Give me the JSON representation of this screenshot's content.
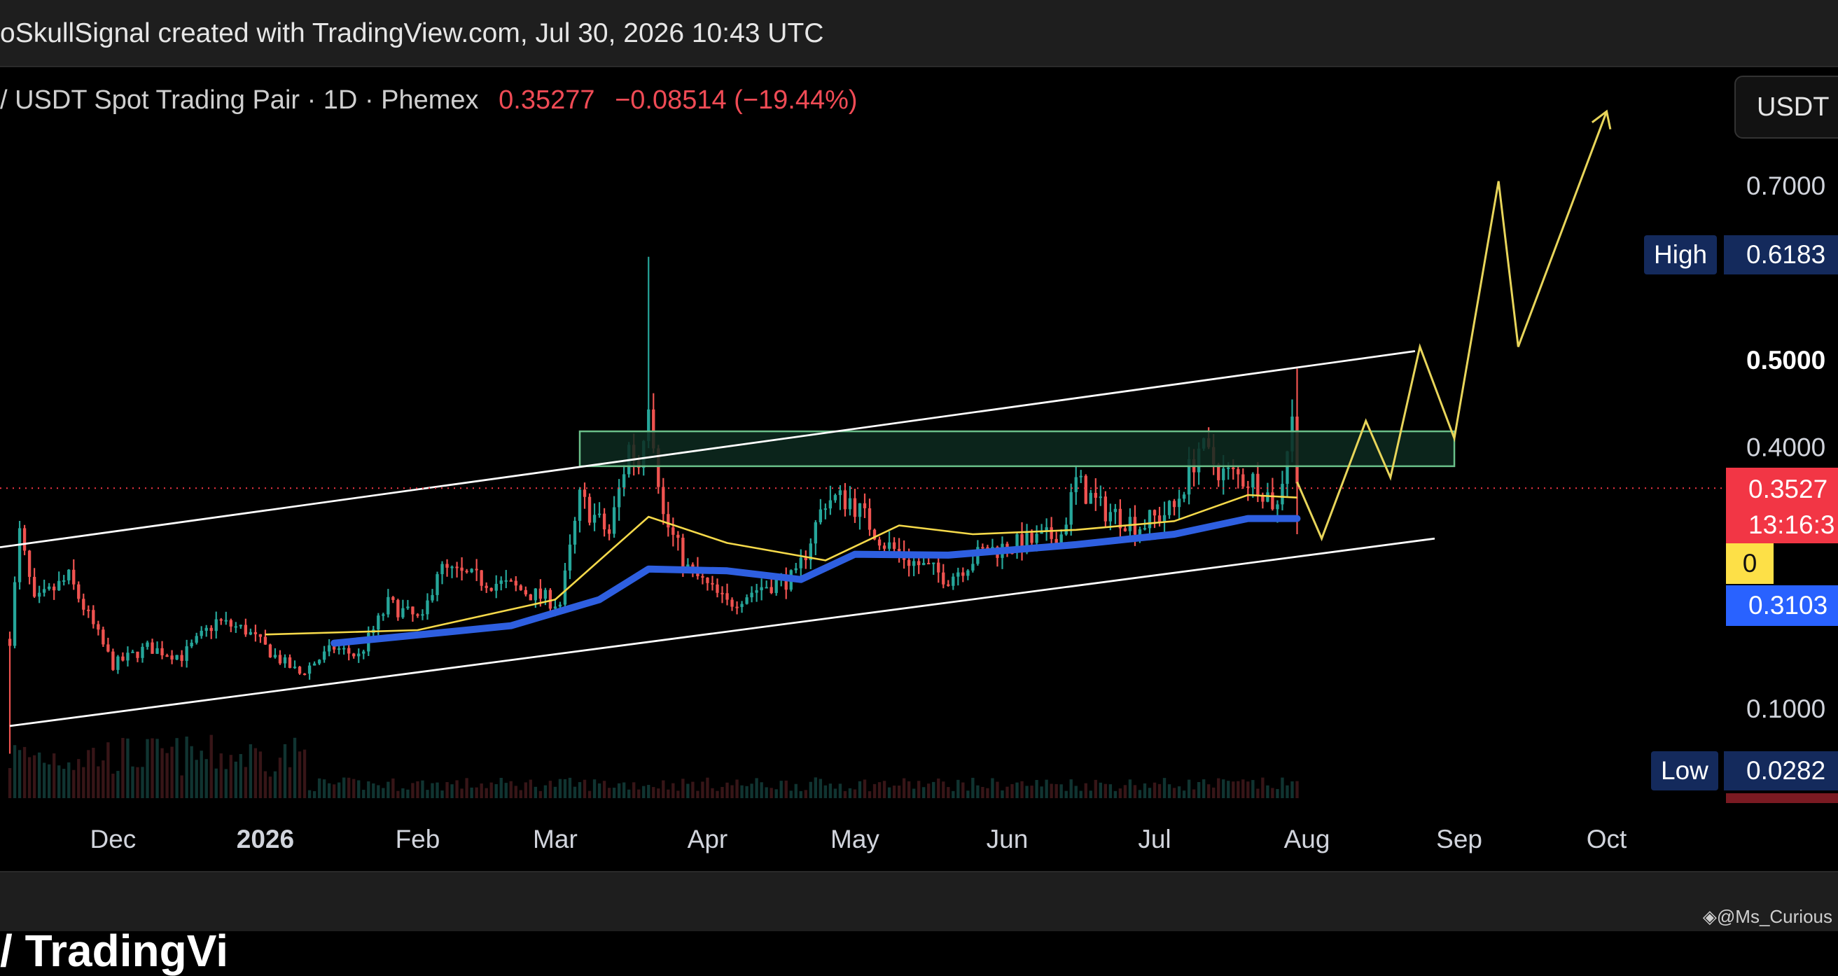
{
  "header": {
    "caption": "oSkullSignal created with TradingView.com, Jul 30, 2026 10:43 UTC"
  },
  "legend": {
    "symbol": "/ USDT Spot Trading Pair · 1D · Phemex",
    "last": "0.35277",
    "change": "−0.08514 (−19.44%)"
  },
  "unit_button": "USDT",
  "markers": {
    "high_label": "High",
    "high_value": "0.6183",
    "low_label": "Low",
    "low_value": "0.0282",
    "price_tag": "0.3527",
    "countdown": "13:16:3",
    "ma_fast_tag": "0",
    "ma_slow_tag": "0.3103"
  },
  "footer": {
    "credit": "@Ms_Curious",
    "logo_text": "/ TradingVi"
  },
  "colors": {
    "background": "#000000",
    "up": "#26a69a",
    "down": "#ef5350",
    "ma_fast": "#f5d94a",
    "ma_slow": "#2e5fe0",
    "channel": "#ffffff",
    "zone": "#1f6b46",
    "projection": "#e8d55a",
    "price_tag": "#f23645",
    "ma_slow_tag": "#2962ff",
    "ma_fast_tag": "#fde047",
    "high_low_tag": "#142a5c"
  },
  "chart_data": {
    "type": "candlestick",
    "xlabel": "",
    "ylabel": "",
    "y_ticks": [
      "0.1000",
      "0.4000",
      "0.5000",
      "0.7000"
    ],
    "ylim": [
      0.0,
      0.82
    ],
    "x_ticks": [
      {
        "date": "2025-12-01",
        "label": "Dec"
      },
      {
        "date": "2026-01-01",
        "label": "2026"
      },
      {
        "date": "2026-02-01",
        "label": "Feb"
      },
      {
        "date": "2026-03-01",
        "label": "Mar"
      },
      {
        "date": "2026-04-01",
        "label": "Apr"
      },
      {
        "date": "2026-05-01",
        "label": "May"
      },
      {
        "date": "2026-06-01",
        "label": "Jun"
      },
      {
        "date": "2026-07-01",
        "label": "Jul"
      },
      {
        "date": "2026-08-01",
        "label": "Aug"
      },
      {
        "date": "2026-09-01",
        "label": "Sep"
      },
      {
        "date": "2026-10-01",
        "label": "Oct"
      }
    ],
    "xlim": [
      "2025-11-08",
      "2026-10-26"
    ],
    "price_anchors": [
      [
        "2025-11-10",
        0.18
      ],
      [
        "2025-11-12",
        0.3
      ],
      [
        "2025-11-15",
        0.22
      ],
      [
        "2025-11-22",
        0.25
      ],
      [
        "2025-12-01",
        0.15
      ],
      [
        "2025-12-08",
        0.17
      ],
      [
        "2025-12-15",
        0.16
      ],
      [
        "2025-12-22",
        0.2
      ],
      [
        "2025-12-28",
        0.19
      ],
      [
        "2026-01-03",
        0.16
      ],
      [
        "2026-01-08",
        0.14
      ],
      [
        "2026-01-15",
        0.17
      ],
      [
        "2026-01-20",
        0.16
      ],
      [
        "2026-01-26",
        0.22
      ],
      [
        "2026-02-02",
        0.2
      ],
      [
        "2026-02-05",
        0.26
      ],
      [
        "2026-02-12",
        0.25
      ],
      [
        "2026-02-20",
        0.24
      ],
      [
        "2026-02-25",
        0.23
      ],
      [
        "2026-03-02",
        0.22
      ],
      [
        "2026-03-06",
        0.34
      ],
      [
        "2026-03-12",
        0.3
      ],
      [
        "2026-03-16",
        0.4
      ],
      [
        "2026-03-18",
        0.38
      ],
      [
        "2026-03-20",
        0.46
      ],
      [
        "2026-03-23",
        0.32
      ],
      [
        "2026-03-28",
        0.26
      ],
      [
        "2026-04-05",
        0.22
      ],
      [
        "2026-04-12",
        0.24
      ],
      [
        "2026-04-19",
        0.25
      ],
      [
        "2026-04-25",
        0.34
      ],
      [
        "2026-04-30",
        0.34
      ],
      [
        "2026-05-07",
        0.29
      ],
      [
        "2026-05-12",
        0.27
      ],
      [
        "2026-05-20",
        0.25
      ],
      [
        "2026-05-27",
        0.28
      ],
      [
        "2026-06-05",
        0.29
      ],
      [
        "2026-06-12",
        0.3
      ],
      [
        "2026-06-15",
        0.36
      ],
      [
        "2026-06-20",
        0.33
      ],
      [
        "2026-06-28",
        0.31
      ],
      [
        "2026-07-05",
        0.33
      ],
      [
        "2026-07-10",
        0.4
      ],
      [
        "2026-07-15",
        0.37
      ],
      [
        "2026-07-22",
        0.36
      ],
      [
        "2026-07-26",
        0.33
      ],
      [
        "2026-07-29",
        0.44
      ],
      [
        "2026-07-30",
        0.35277
      ]
    ],
    "ohlc_summary": {
      "high": 0.6183,
      "low": 0.0282,
      "last": 0.35277,
      "change": -0.08514,
      "change_pct": -19.44
    },
    "ma_fast": [
      [
        "2026-01-01",
        0.185
      ],
      [
        "2026-02-01",
        0.19
      ],
      [
        "2026-03-01",
        0.225
      ],
      [
        "2026-03-20",
        0.32
      ],
      [
        "2026-04-05",
        0.29
      ],
      [
        "2026-04-25",
        0.27
      ],
      [
        "2026-05-10",
        0.31
      ],
      [
        "2026-05-25",
        0.3
      ],
      [
        "2026-06-15",
        0.305
      ],
      [
        "2026-07-05",
        0.315
      ],
      [
        "2026-07-20",
        0.345
      ],
      [
        "2026-07-30",
        0.342
      ]
    ],
    "ma_slow": [
      [
        "2026-01-15",
        0.175
      ],
      [
        "2026-02-20",
        0.195
      ],
      [
        "2026-03-10",
        0.225
      ],
      [
        "2026-03-20",
        0.26
      ],
      [
        "2026-04-05",
        0.258
      ],
      [
        "2026-04-20",
        0.248
      ],
      [
        "2026-05-01",
        0.277
      ],
      [
        "2026-05-20",
        0.276
      ],
      [
        "2026-06-15",
        0.288
      ],
      [
        "2026-07-05",
        0.3
      ],
      [
        "2026-07-20",
        0.318
      ],
      [
        "2026-07-30",
        0.318
      ]
    ],
    "channel_upper": [
      [
        "2025-11-08",
        0.285
      ],
      [
        "2026-08-23",
        0.51
      ]
    ],
    "channel_lower": [
      [
        "2025-11-10",
        0.08
      ],
      [
        "2026-08-27",
        0.295
      ]
    ],
    "supply_zone": {
      "x0": "2026-03-06",
      "x1": "2026-08-31",
      "y0": 0.378,
      "y1": 0.418
    },
    "projection": [
      [
        "2026-07-30",
        0.36
      ],
      [
        "2026-08-04",
        0.295
      ],
      [
        "2026-08-13",
        0.43
      ],
      [
        "2026-08-18",
        0.365
      ],
      [
        "2026-08-24",
        0.515
      ],
      [
        "2026-08-31",
        0.41
      ],
      [
        "2026-09-09",
        0.705
      ],
      [
        "2026-09-13",
        0.515
      ],
      [
        "2026-10-01",
        0.785
      ]
    ]
  }
}
